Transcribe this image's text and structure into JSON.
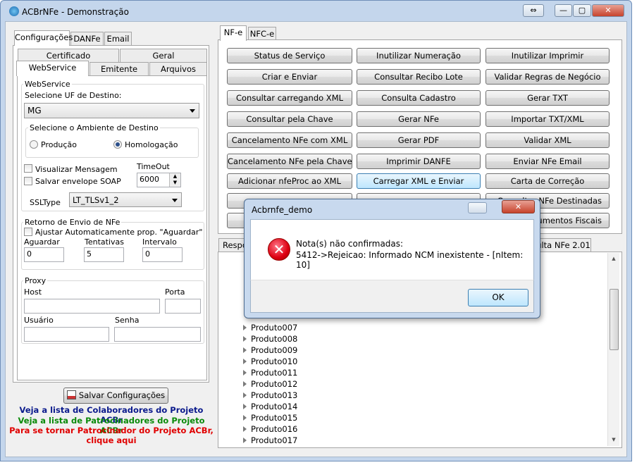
{
  "window": {
    "title": "ACBrNFe - Demonstração",
    "restore_label": "⇔",
    "minimize_label": "—",
    "maximize_label": "▢",
    "close_label": "✕"
  },
  "left_tabs": [
    "Configurações",
    "DANFe",
    "Email"
  ],
  "config_tabs_row1": [
    "Certificado",
    "Geral"
  ],
  "config_tabs_row2": [
    "WebService",
    "Emitente",
    "Arquivos"
  ],
  "webservice": {
    "group_label": "WebService",
    "uf_label": "Selecione UF de Destino:",
    "uf_value": "MG",
    "ambiente_label": "Selecione o Ambiente de Destino",
    "producao": "Produção",
    "homologacao": "Homologação",
    "visualizar": "Visualizar Mensagem",
    "salvar_soap": "Salvar envelope SOAP",
    "timeout_label": "TimeOut",
    "timeout_value": "6000",
    "ssltype_label": "SSLType",
    "ssltype_value": "LT_TLSv1_2"
  },
  "retorno": {
    "group_label": "Retorno de Envio de NFe",
    "ajustar": "Ajustar Automaticamente prop. \"Aguardar\"",
    "aguardar_label": "Aguardar",
    "aguardar_value": "0",
    "tentativas_label": "Tentativas",
    "tentativas_value": "5",
    "intervalo_label": "Intervalo",
    "intervalo_value": "0"
  },
  "proxy": {
    "group_label": "Proxy",
    "host": "Host",
    "porta": "Porta",
    "usuario": "Usuário",
    "senha": "Senha"
  },
  "save_button": "Salvar Configurações",
  "links": {
    "colaboradores": "Veja a lista de Colaboradores do Projeto ACBr",
    "patrocinadores": "Veja a lista de Patrocinadores do Projeto ACBr",
    "patrocinador1": "Para se tornar Patrocinador do Projeto ACBr,",
    "patrocinador2": "clique aqui"
  },
  "colors": {
    "link_blue": "#0a1a8c",
    "link_green": "#0a8a0a",
    "link_red": "#e00000"
  },
  "right_tabs": [
    "NF-e",
    "NFC-e"
  ],
  "buttons": [
    [
      "Status de Serviço",
      "Inutilizar Numeração",
      "Inutilizar Imprimir"
    ],
    [
      "Criar e Enviar",
      "Consultar Recibo Lote",
      "Validar Regras de Negócio"
    ],
    [
      "Consultar carregando XML",
      "Consulta Cadastro",
      "Gerar TXT"
    ],
    [
      "Consultar pela Chave",
      "Gerar NFe",
      "Importar TXT/XML"
    ],
    [
      "Cancelamento NFe com XML",
      "Gerar PDF",
      "Validar XML"
    ],
    [
      "Cancelamento NFe pela Chave",
      "Imprimir DANFE",
      "Enviar NFe Email"
    ],
    [
      "Adicionar nfeProc ao XML",
      "Carregar XML e Enviar",
      "Carta de Correção"
    ],
    [
      "",
      "",
      "Consultar NFe Destinadas"
    ],
    [
      "",
      "",
      "Documentos Fiscais"
    ]
  ],
  "bottom_tabs": {
    "left": "Respo",
    "right": "ulta NFe 2.01"
  },
  "tree_items": [
    "Produto007",
    "Produto008",
    "Produto009",
    "Produto010",
    "Produto011",
    "Produto012",
    "Produto013",
    "Produto014",
    "Produto015",
    "Produto016",
    "Produto017"
  ],
  "dialog": {
    "title": "Acbrnfe_demo",
    "heading": "Nota(s) não confirmadas:",
    "message": "5412->Rejeicao: Informado NCM inexistente - [nItem: 10]",
    "ok": "OK",
    "close": "✕"
  }
}
